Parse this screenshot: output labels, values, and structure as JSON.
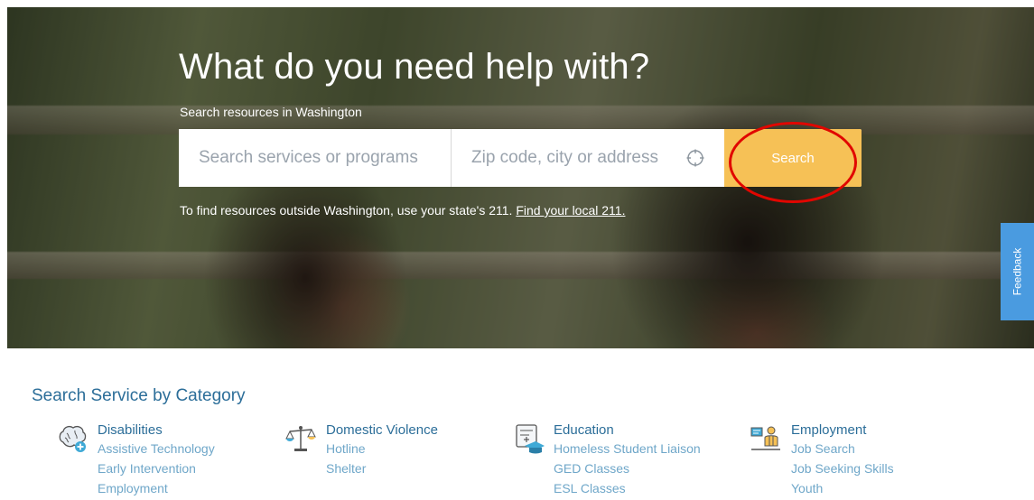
{
  "hero": {
    "title": "What do you need help with?",
    "subtitle": "Search resources in Washington",
    "search_placeholder": "Search services or programs",
    "location_placeholder": "Zip code, city or address",
    "search_button": "Search",
    "note_text": "To find resources outside Washington, use your state's 211. ",
    "note_link": "Find your local 211."
  },
  "feedback": {
    "label": "Feedback"
  },
  "categories": {
    "title": "Search Service by Category",
    "items": [
      {
        "name": "Disabilities",
        "icon": "brain-plus-icon",
        "links": [
          "Assistive Technology",
          "Early Intervention",
          "Employment"
        ]
      },
      {
        "name": "Domestic Violence",
        "icon": "scales-icon",
        "links": [
          "Hotline",
          "Shelter"
        ]
      },
      {
        "name": "Education",
        "icon": "education-icon",
        "links": [
          "Homeless Student Liaison",
          "GED Classes",
          "ESL Classes"
        ]
      },
      {
        "name": "Employment",
        "icon": "employment-icon",
        "links": [
          "Job Search",
          "Job Seeking Skills",
          "Youth"
        ]
      }
    ]
  },
  "colors": {
    "accent": "#f6c156",
    "link": "#2c6e99",
    "sublink": "#6fa7c9",
    "feedback": "#4a9be0",
    "highlight": "#e10600"
  }
}
